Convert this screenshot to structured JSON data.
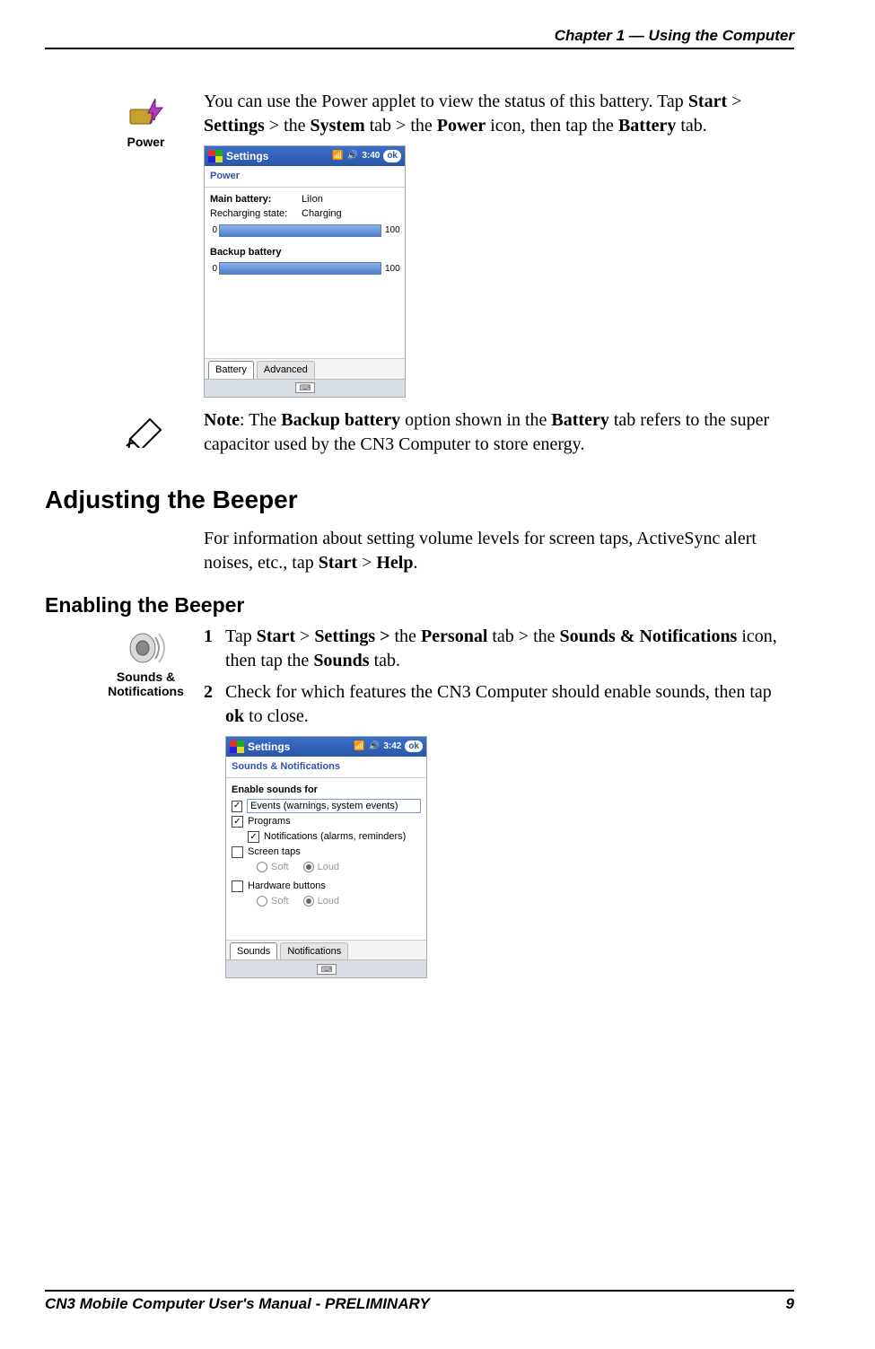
{
  "header": "Chapter 1 —  Using the Computer",
  "footer_left": "CN3 Mobile Computer User's Manual - PRELIMINARY",
  "footer_right": "9",
  "power_icon_label": "Power",
  "intro": {
    "t1": "You can use the Power applet to view the status of this battery. Tap ",
    "b1": "Start",
    "t2": " > ",
    "b2": "Settings",
    "t3": " > the ",
    "b3": "System",
    "t4": " tab > the ",
    "b4": "Power",
    "t5": " icon, then tap the ",
    "b5": "Battery",
    "t6": " tab."
  },
  "ppc1": {
    "title": "Settings",
    "time": "3:40",
    "ok": "ok",
    "subtitle": "Power",
    "main_k": "Main battery:",
    "main_v": "LiIon",
    "rech_k": "Recharging state:",
    "rech_v": "Charging",
    "bar_start": "0",
    "bar_end": "100",
    "backup": "Backup battery",
    "tab1": "Battery",
    "tab2": "Advanced"
  },
  "note": {
    "pre": "Note",
    "t1": ": The ",
    "b1": "Backup battery",
    "t2": " option shown in the ",
    "b2": "Battery",
    "t3": " tab refers to the super capacitor used by the CN3 Computer to store energy."
  },
  "h2": "Adjusting the Beeper",
  "para2": {
    "t1": "For information about setting volume levels for screen taps, ActiveSync alert noises, etc., tap ",
    "b1": "Start",
    "t2": " > ",
    "b2": "Help",
    "t3": "."
  },
  "h3": "Enabling the Beeper",
  "sounds_icon_label": "Sounds & Notifications",
  "step1": {
    "num": "1",
    "t1": "Tap ",
    "b1": "Start",
    "t2": " > ",
    "b2": "Settings > ",
    "t3": "the ",
    "b3": "Personal",
    "t4": " tab > the ",
    "b4": "Sounds & Notifica­tions",
    "t5": " icon, then tap the ",
    "b5": "Sounds",
    "t6": " tab."
  },
  "step2": {
    "num": "2",
    "t1": "Check for which features the CN3 Computer should enable sounds, then tap ",
    "b1": "ok",
    "t2": " to close."
  },
  "ppc2": {
    "title": "Settings",
    "time": "3:42",
    "ok": "ok",
    "subtitle": "Sounds & Notifications",
    "fs": "Enable sounds for",
    "evt": "Events (warnings, system events)",
    "prog": "Programs",
    "notif": "Notifications (alarms, reminders)",
    "taps": "Screen taps",
    "soft": "Soft",
    "loud": "Loud",
    "hw": "Hardware buttons",
    "tab1": "Sounds",
    "tab2": "Notifications"
  }
}
